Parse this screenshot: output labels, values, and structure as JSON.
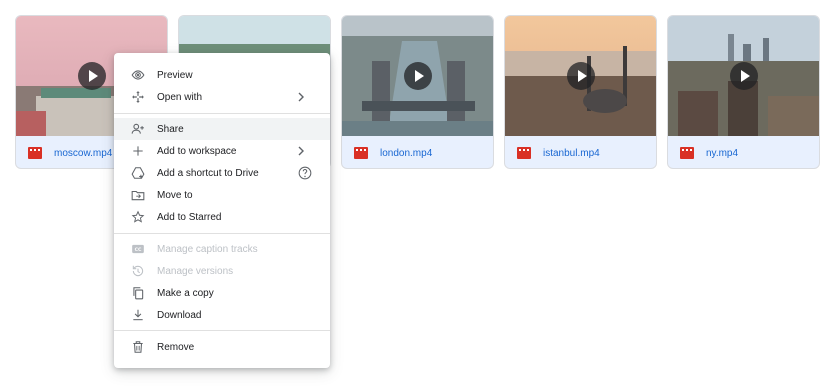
{
  "files": [
    {
      "name": "moscow.mp4",
      "icon": "video-file-icon"
    },
    {
      "name": "",
      "icon": "video-file-icon"
    },
    {
      "name": "london.mp4",
      "icon": "video-file-icon"
    },
    {
      "name": "istanbul.mp4",
      "icon": "video-file-icon"
    },
    {
      "name": "ny.mp4",
      "icon": "video-file-icon"
    }
  ],
  "context_menu": {
    "preview": "Preview",
    "open_with": "Open with",
    "share": "Share",
    "add_to_workspace": "Add to workspace",
    "add_shortcut": "Add a shortcut to Drive",
    "move_to": "Move to",
    "add_starred": "Add to Starred",
    "manage_captions": "Manage caption tracks",
    "manage_versions": "Manage versions",
    "make_copy": "Make a copy",
    "download": "Download",
    "remove": "Remove"
  },
  "colors": {
    "accent": "#1967d2",
    "video_icon": "#d93025",
    "card_bg": "#e8f0fe",
    "disabled": "#bdc1c6"
  }
}
